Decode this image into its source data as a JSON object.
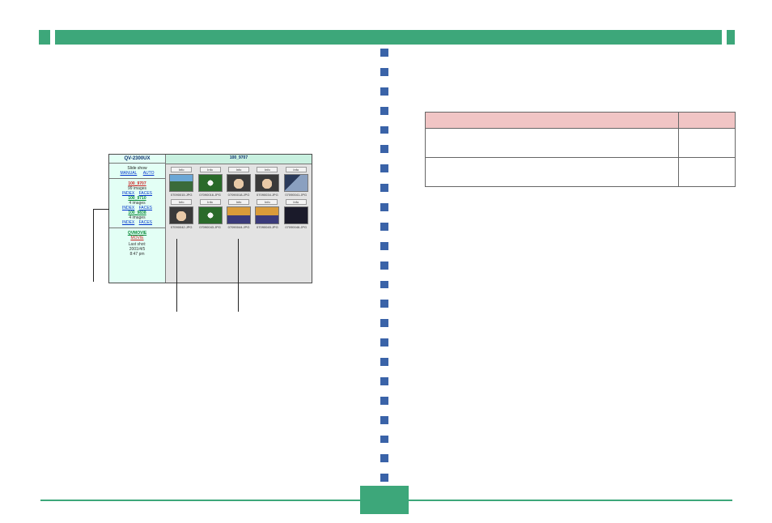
{
  "page_number": "",
  "shot": {
    "title": "QV-2300UX",
    "slideshow_label": "Slide show",
    "link1": "MANUAL",
    "link2": "AUTO",
    "albums": [
      {
        "name": "100_9707",
        "count": "99 images",
        "links": [
          "INDEX",
          "FACES"
        ],
        "highlight": true
      },
      {
        "name": "100_9710",
        "count": "4 images",
        "links": [
          "INDEX",
          "FACES"
        ],
        "highlight": false
      },
      {
        "name": "100_9838",
        "count": "4 images",
        "links": [
          "INDEX",
          "FACES"
        ],
        "highlight": false
      }
    ],
    "movie_section_title": "QVMOVIE",
    "movie_link": "MOVIE",
    "movie_info": [
      "Last shot:",
      "2001/4/5",
      "8:47 pm"
    ],
    "current_album": "100_9707",
    "thumb_button_labels": [
      "Info",
      "Info",
      "Info",
      "Info",
      "Info"
    ],
    "thumb_filenames_row1": [
      "07090015.JPG",
      "07090016.JPG",
      "07090018.JPG",
      "07090034.JPG",
      "07090041.JPG"
    ],
    "thumb_filenames_row2": [
      "07090042.JPG",
      "07090043.JPG",
      "07090044.JPG",
      "07090045.JPG",
      "07090046.JPG"
    ]
  },
  "rtable": {
    "header1": "",
    "header2": "",
    "rows": [
      {
        "c1": "",
        "c2": ""
      },
      {
        "c1": "",
        "c2": ""
      }
    ]
  },
  "colors": {
    "green": "#3da77a",
    "blue_square": "#3a63a8",
    "table_header": "#f1c5c5"
  }
}
